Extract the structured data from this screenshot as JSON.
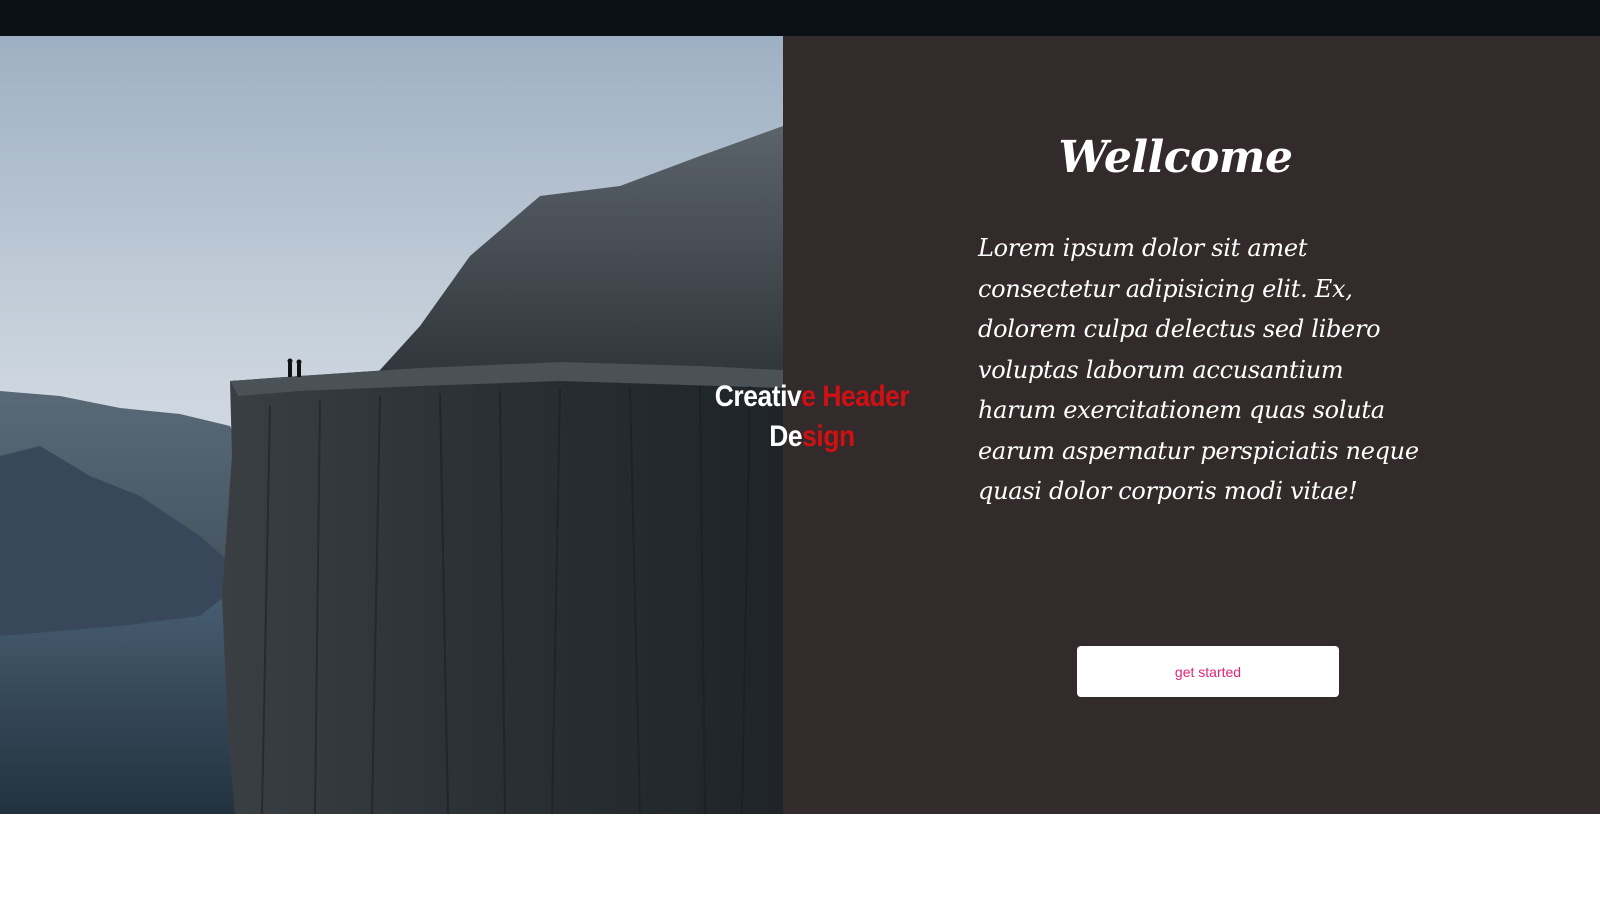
{
  "hero": {
    "logo": {
      "part1": "Creativ",
      "part2": "e Header",
      "part3": "De",
      "part4": "sign",
      "colors": {
        "primary": "#ffffff",
        "accent": "#d11014"
      }
    },
    "title": "Wellcome",
    "body": "Lorem ipsum dolor sit amet consectetur adipisicing elit. Ex, dolorem culpa delectus sed libero voluptas laborum accusantium harum exercitationem quas soluta earum aspernatur perspiciatis neque quasi dolor corporis modi vitae!",
    "cta_label": "get started",
    "colors": {
      "panel_bg": "#332b2b",
      "topbar_bg": "#0b1116",
      "cta_text": "#e0247a"
    }
  }
}
